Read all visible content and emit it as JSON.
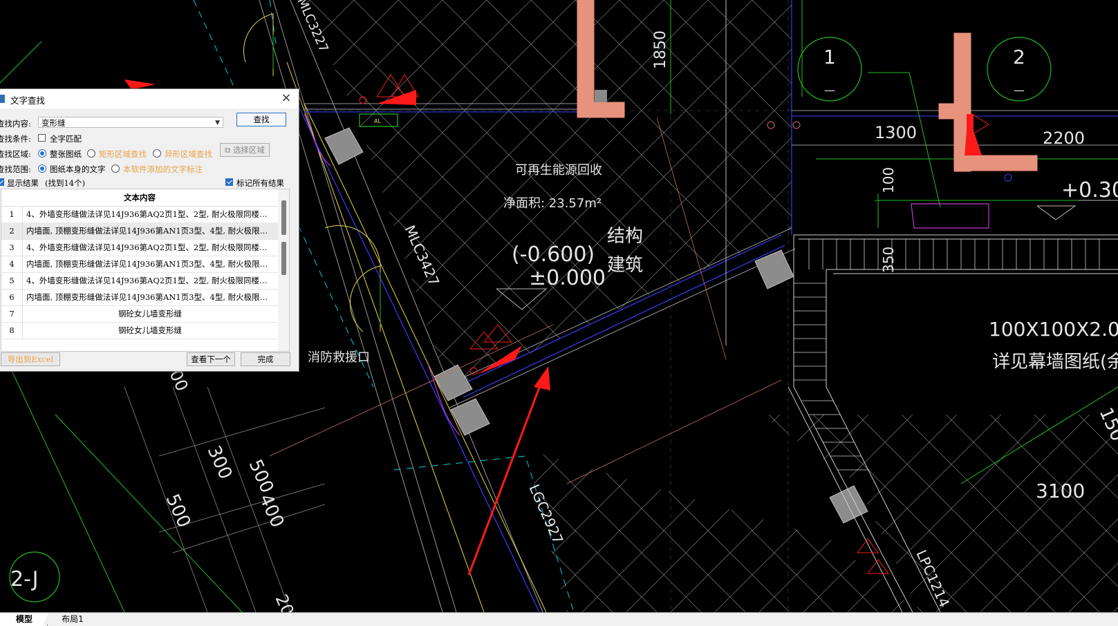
{
  "drawing": {
    "texts": {
      "room_name": "可再生能源回收",
      "net_area": "净面积: 23.57m²",
      "level_struct": "(-0.600)",
      "level_arch": "±0.000",
      "label_struct": "结构",
      "label_arch": "建筑",
      "fire_rescue": "消防救援口",
      "curtain_size": "100X100X2.0",
      "curtain_note": "详见幕墙图纸(余同)",
      "window_mlc3427": "MLC3427",
      "window_mlc3227": "MLC3227",
      "window_lgc2927": "LGC2927",
      "window_lpc1214": "LPC1214",
      "dim_1850": "1850",
      "dim_1300": "1300",
      "dim_2200": "2200",
      "dim_100": "100",
      "dim_350": "350",
      "dim_3100": "3100",
      "dim_300": "300",
      "dim_500": "500",
      "dim_500b": "500",
      "dim_400": "400",
      "dim_150": "150",
      "dim_00": "00",
      "dim_20": "20",
      "level_right": "+0.30",
      "axis_1": "1",
      "axis_2": "2",
      "axis_2j": "2-J",
      "axis_dash": "—",
      "small_tag": "AL"
    }
  },
  "dialog": {
    "title": "文字查找",
    "search_label": "查找内容:",
    "search_value": "变形缝",
    "search_button": "查找",
    "condition_label": "查找条件:",
    "whole_word_label": "全字匹配",
    "area_label": "查找区域:",
    "area_whole": "整张图纸",
    "area_rect": "矩形区域查找",
    "area_irregular": "异形区域查找",
    "select_area_button": "选择区域",
    "scope_label": "查找范围:",
    "scope_drawing": "图纸本身的文字",
    "scope_software": "本软件添加的文字标注",
    "show_results_label": "显示结果",
    "results_count": "(找到14个)",
    "mark_all_label": "标记所有结果",
    "table_header": "文本内容",
    "rows": [
      {
        "num": "1",
        "text": "4、外墙变形缝做法详见14J936第AQ2页1型、2型, 耐火极限同楼…"
      },
      {
        "num": "2",
        "text": "内墙面, 顶棚变形缝做法详见14J936第AN1页3型、4型, 耐火极限…"
      },
      {
        "num": "3",
        "text": "4、外墙变形缝做法详见14J936第AQ2页1型、2型, 耐火极限同楼…"
      },
      {
        "num": "4",
        "text": "内墙面, 顶棚变形缝做法详见14J936第AN1页3型、4型, 耐火极限…"
      },
      {
        "num": "5",
        "text": "4、外墙变形缝做法详见14J936第AQ2页1型、2型, 耐火极限同楼…"
      },
      {
        "num": "6",
        "text": "内墙面, 顶棚变形缝做法详见14J936第AN1页3型、4型, 耐火极限…"
      },
      {
        "num": "7",
        "text": "钢砼女儿墙变形缝"
      },
      {
        "num": "8",
        "text": "钢砼女儿墙变形缝"
      }
    ],
    "export_button": "导出到Excel",
    "next_button": "查看下一个",
    "done_button": "完成"
  },
  "tabs": {
    "model": "模型",
    "layout1": "布局1"
  },
  "colors": {
    "background": "#000000",
    "cyan": "#00cfe0",
    "green": "#1ec21e",
    "yellow": "#e8d84a",
    "red": "#ff1a1a",
    "salmon": "#e7927c",
    "magenta": "#c23ad0",
    "accent": "#2a6fc9"
  }
}
